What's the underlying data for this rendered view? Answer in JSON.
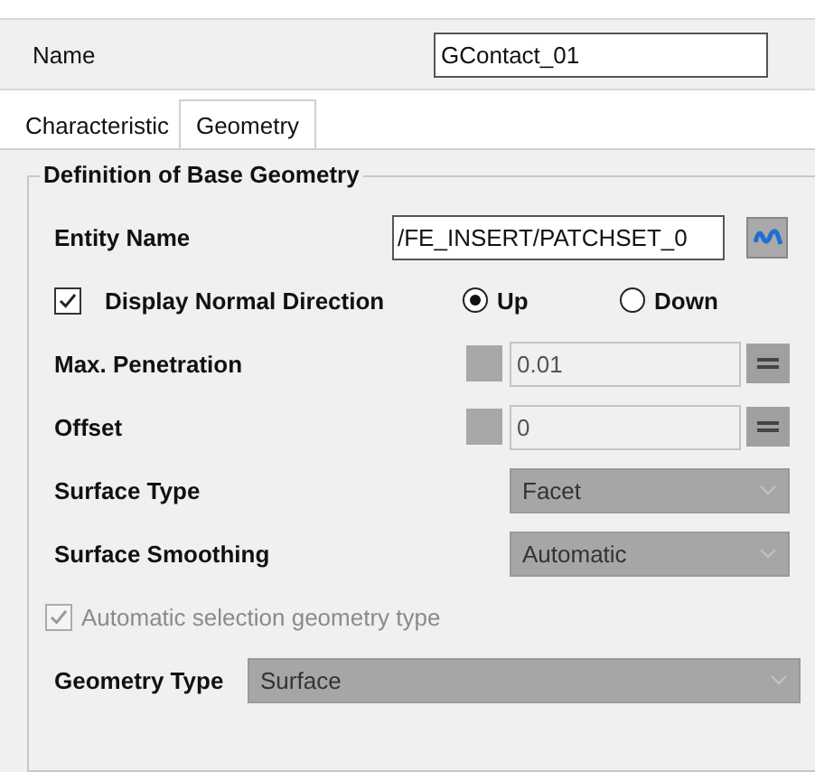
{
  "name_field": {
    "label": "Name",
    "value": "GContact_01"
  },
  "tabs": [
    {
      "label": "Characteristic",
      "selected": false
    },
    {
      "label": "Geometry",
      "selected": true
    }
  ],
  "group": {
    "title": "Definition of Base Geometry",
    "rows": [
      {
        "kind": "entity",
        "label": "Entity Name",
        "value": "/FE_INSERT/PATCHSET_0"
      },
      {
        "kind": "normal",
        "label": "Display Normal Direction",
        "checked": true,
        "options": [
          {
            "label": "Up",
            "selected": true
          },
          {
            "label": "Down",
            "selected": false
          }
        ]
      },
      {
        "kind": "numeric",
        "label": "Max. Penetration",
        "value": "0.01"
      },
      {
        "kind": "numeric",
        "label": "Offset",
        "value": "0"
      },
      {
        "kind": "dropdown",
        "label": "Surface Type",
        "value": "Facet",
        "disabled": true
      },
      {
        "kind": "dropdown",
        "label": "Surface Smoothing",
        "value": "Automatic",
        "disabled": true
      },
      {
        "kind": "checkbox",
        "label": "Automatic selection geometry type",
        "checked": true,
        "disabled": true
      },
      {
        "kind": "wide_dropdown",
        "label": "Geometry Type",
        "value": "Surface",
        "disabled": true
      }
    ]
  }
}
